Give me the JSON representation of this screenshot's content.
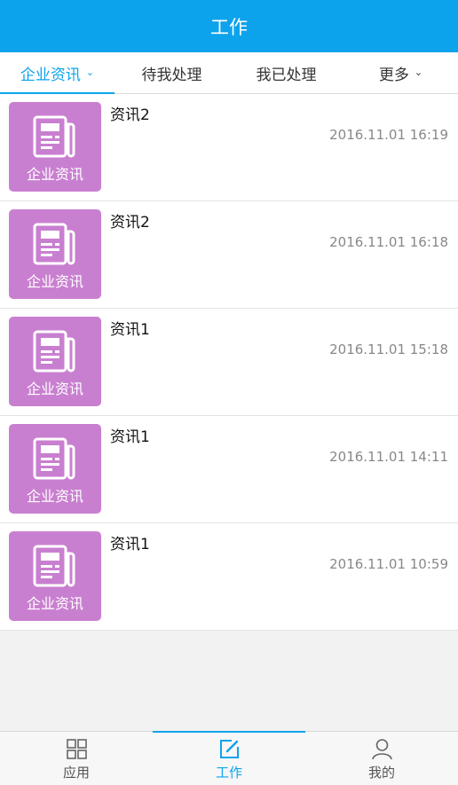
{
  "header": {
    "title": "工作"
  },
  "tabs": [
    {
      "label": "企业资讯",
      "active": true,
      "chevron": true
    },
    {
      "label": "待我处理",
      "active": false,
      "chevron": false
    },
    {
      "label": "我已处理",
      "active": false,
      "chevron": false
    },
    {
      "label": "更多",
      "active": false,
      "chevron": true
    }
  ],
  "items": [
    {
      "title": "资讯2",
      "time": "2016.11.01 16:19",
      "category": "企业资讯"
    },
    {
      "title": "资讯2",
      "time": "2016.11.01 16:18",
      "category": "企业资讯"
    },
    {
      "title": "资讯1",
      "time": "2016.11.01 15:18",
      "category": "企业资讯"
    },
    {
      "title": "资讯1",
      "time": "2016.11.01 14:11",
      "category": "企业资讯"
    },
    {
      "title": "资讯1",
      "time": "2016.11.01 10:59",
      "category": "企业资讯"
    }
  ],
  "bottom_nav": [
    {
      "label": "应用",
      "icon": "grid-icon",
      "active": false
    },
    {
      "label": "工作",
      "icon": "edit-icon",
      "active": true
    },
    {
      "label": "我的",
      "icon": "person-icon",
      "active": false
    }
  ],
  "colors": {
    "accent": "#0da3ec",
    "thumb": "#c97fd0"
  }
}
